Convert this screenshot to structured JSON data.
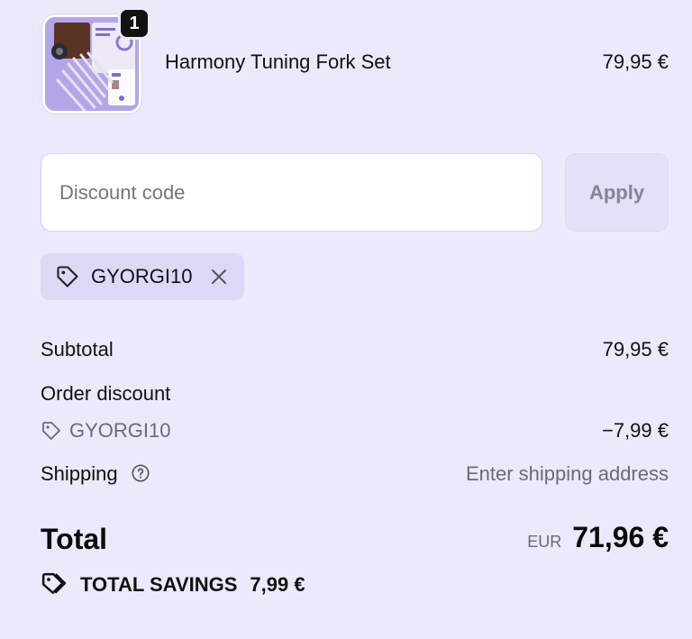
{
  "cart": {
    "item": {
      "name": "Harmony Tuning Fork Set",
      "price": "79,95 €",
      "quantity": "1",
      "thumbnail_icon": "tuning-fork-product-image"
    }
  },
  "discount": {
    "placeholder": "Discount code",
    "value": "",
    "apply_label": "Apply",
    "applied_code": "GYORGI10"
  },
  "summary": {
    "subtotal_label": "Subtotal",
    "subtotal_value": "79,95 €",
    "order_discount_label": "Order discount",
    "discount_code": "GYORGI10",
    "discount_value": "−7,99 €",
    "shipping_label": "Shipping",
    "shipping_value": "Enter shipping address",
    "total_label": "Total",
    "currency": "EUR",
    "total_value": "71,96 €",
    "savings_label": "TOTAL SAVINGS",
    "savings_value": "7,99 €"
  },
  "colors": {
    "background": "#ebe9fb",
    "chip": "#dcd8f6",
    "apply_button": "#e3e0f7",
    "text": "#111111",
    "muted_text": "#6c6a76"
  }
}
